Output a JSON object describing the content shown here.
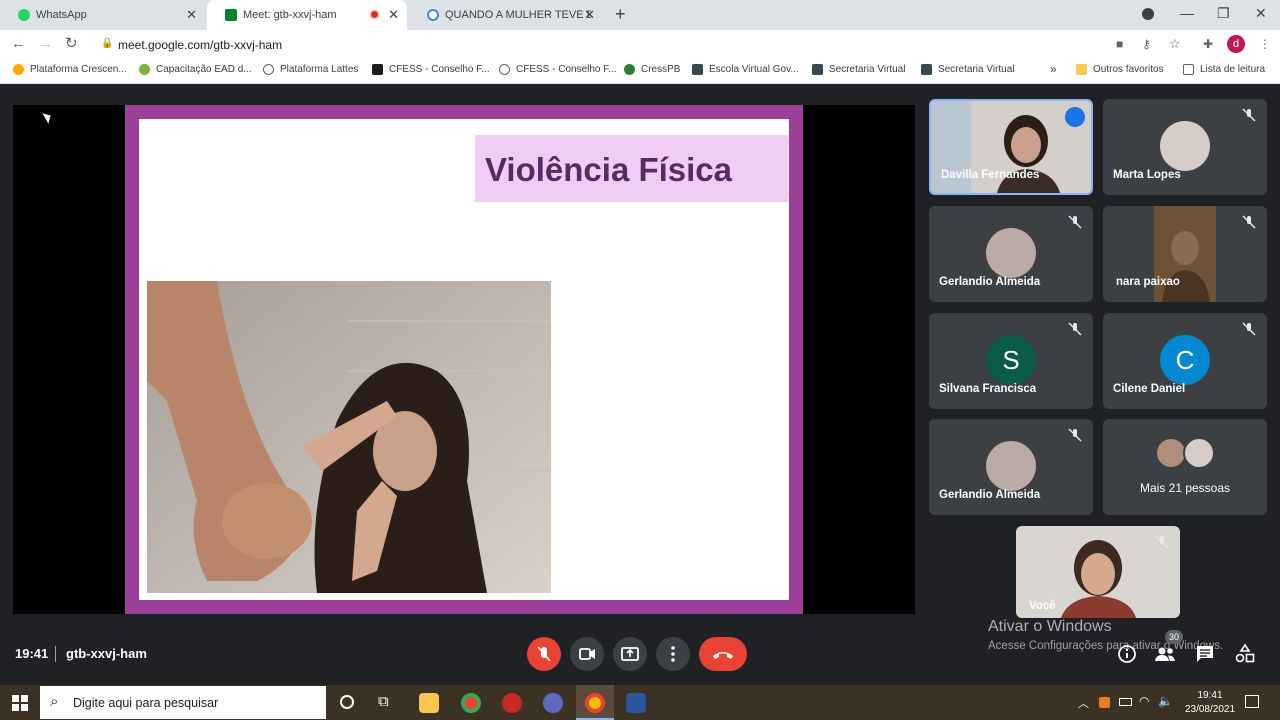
{
  "browser": {
    "tabs": [
      {
        "title": "WhatsApp",
        "color": "#25d366"
      },
      {
        "title": "Meet: gtb-xxvj-ham",
        "color": "#00832d"
      },
      {
        "title": "QUANDO A MULHER TEVE DIREITO",
        "color": "#4285f4"
      }
    ],
    "url": "meet.google.com/gtb-xxvj-ham",
    "profile_initial": "d",
    "bookmarks": [
      "Plataforma Crescen...",
      "Capacitação EAD d...",
      "Plataforma Lattes",
      "CFESS - Conselho F...",
      "CFESS - Conselho F...",
      "CressPB",
      "Escola Virtual Gov...",
      "Secretaria Virtual",
      "Secretaria Virtual"
    ],
    "bookmarks_more": "»",
    "other_favorites": "Outros favoritos",
    "reading_list": "Lista de leitura"
  },
  "slide": {
    "title": "Violência Física"
  },
  "participants": [
    {
      "name": "Davilla Fernandes",
      "type": "video",
      "speaking": true
    },
    {
      "name": "Marta Lopes",
      "type": "photo",
      "color": "#d7ccc8"
    },
    {
      "name": "Gerlandio Almeida",
      "type": "photo",
      "color": "#bcaaa4"
    },
    {
      "name": "nara paixao",
      "type": "video"
    },
    {
      "name": "Silvana Francisca",
      "type": "initial",
      "initial": "S",
      "color": "#0b5b4a"
    },
    {
      "name": "Cilene Daniel",
      "type": "initial",
      "initial": "C",
      "color": "#0288d1"
    },
    {
      "name": "Gerlandio Almeida",
      "type": "photo",
      "color": "#bcaaa4"
    },
    {
      "name": "Mais 21 pessoas",
      "type": "more"
    }
  ],
  "self_view": {
    "label": "Você"
  },
  "meeting": {
    "time": "19:41",
    "code": "gtb-xxvj-ham",
    "people_count": "30"
  },
  "windows_watermark": {
    "title": "Ativar o Windows",
    "subtitle": "Acesse Configurações para ativar o Windows."
  },
  "taskbar": {
    "search_placeholder": "Digite aqui para pesquisar",
    "time": "19:41",
    "date": "23/08/2021"
  }
}
